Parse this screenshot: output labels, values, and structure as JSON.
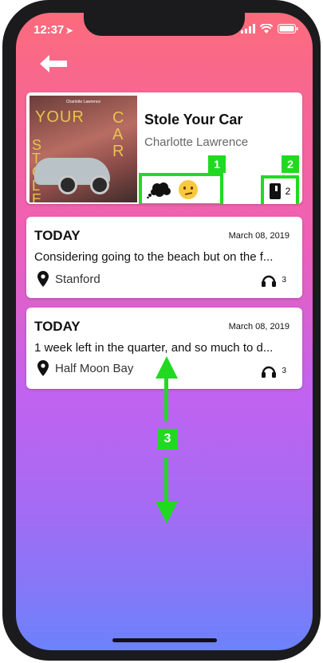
{
  "status_bar": {
    "time": "12:37"
  },
  "song": {
    "title": "Stole Your Car",
    "artist": "Charlotte Lawrence",
    "album_art_small_text": "Charlotte Lawrence",
    "album_art_word1": "YOUR",
    "album_art_word2": "CAR",
    "album_art_word3": "STOLE",
    "count": "2"
  },
  "entries": [
    {
      "day": "TODAY",
      "date": "March 08, 2019",
      "text": "Considering going to the beach but on the f...",
      "location": "Stanford",
      "listens": "3"
    },
    {
      "day": "TODAY",
      "date": "March 08, 2019",
      "text": "1 week left in the quarter, and so much to d...",
      "location": "Half Moon Bay",
      "listens": "3"
    }
  ],
  "annotations": {
    "badge1": "1",
    "badge2": "2",
    "badge3": "3"
  },
  "colors": {
    "gradient_top": "#fc6b7b",
    "gradient_mid": "#c063f0",
    "gradient_bottom": "#6c82fb",
    "annotation_green": "#22d922"
  }
}
